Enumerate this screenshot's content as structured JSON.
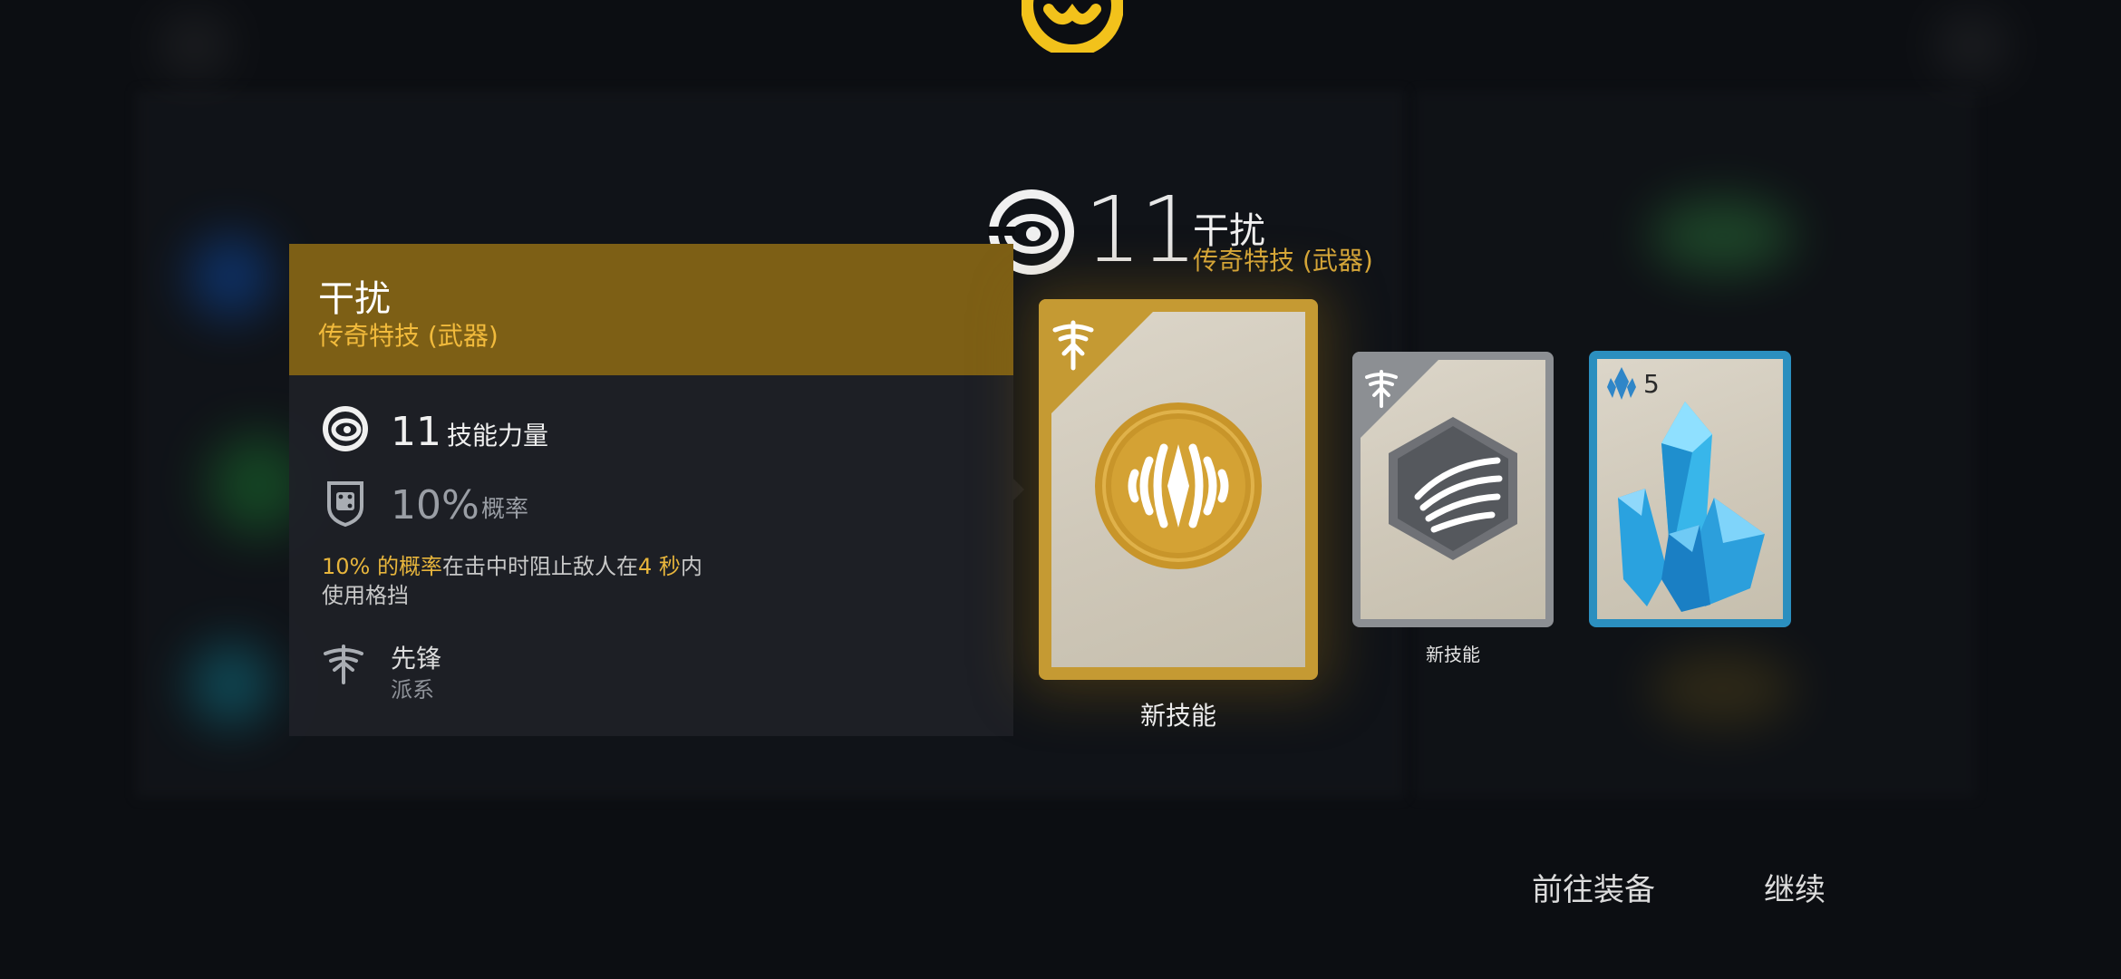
{
  "header": {
    "power_value": "11",
    "title": "干扰",
    "subtitle": "传奇特技 (武器)",
    "icon": "swirl-eye-icon"
  },
  "panel": {
    "title": "干扰",
    "subtitle": "传奇特技 (武器)",
    "power_value": "11",
    "power_label": "技能力量",
    "chance_value": "10%",
    "chance_label": "概率",
    "description": {
      "hl1": "10% 的概率",
      "t1": "在击中时阻止敌人在",
      "hl2": "4 秒",
      "t2": "内",
      "t3": "使用格挡"
    },
    "class_name": "先锋",
    "class_label": "派系",
    "colors": {
      "header_bg": "#7d5f15",
      "highlight": "#e7b53c"
    }
  },
  "cards": [
    {
      "label": "新技能",
      "rarity": "legendary",
      "icon": "interference-emblem-icon",
      "corner_icon": "vanguard-icon"
    },
    {
      "label": "新技能",
      "rarity": "common",
      "icon": "claw-hexagon-icon",
      "corner_icon": "vanguard-icon"
    },
    {
      "count": "5",
      "rarity": "rare",
      "icon": "blue-crystal-icon",
      "corner_icon": "crystal-small-icon"
    }
  ],
  "buttons": {
    "equip": "前往装备",
    "continue": "继续"
  }
}
